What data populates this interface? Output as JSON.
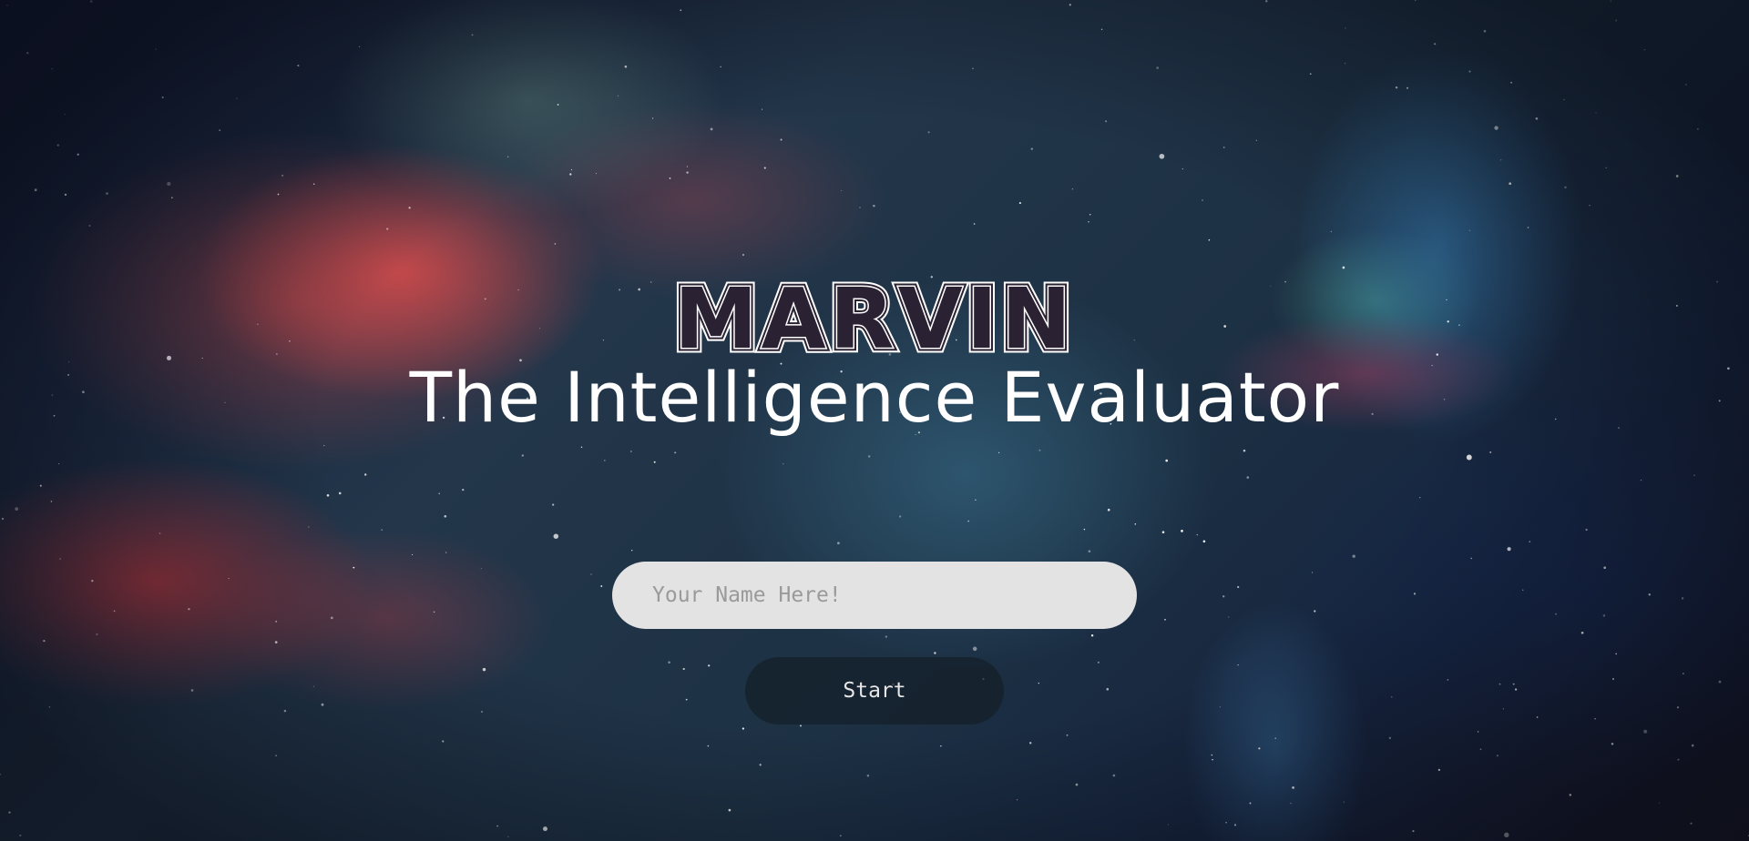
{
  "hero": {
    "logo": "MARVIN",
    "subtitle": "The Intelligence Evaluator"
  },
  "form": {
    "name_placeholder": "Your Name Here!",
    "name_value": "",
    "start_label": "Start"
  },
  "colors": {
    "input_background": "#e3e3e3",
    "button_background": "#14202a",
    "text": "#ffffff"
  }
}
